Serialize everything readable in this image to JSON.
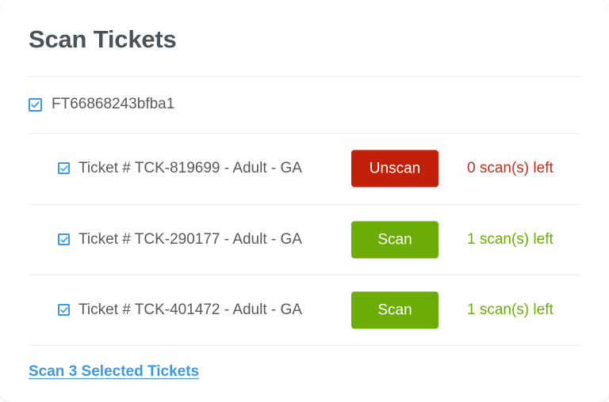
{
  "page": {
    "title": "Scan Tickets"
  },
  "order": {
    "code": "FT66868243bfba1",
    "checkbox_icon": "checkbox-checked-icon",
    "checked": true
  },
  "tickets": [
    {
      "label": "Ticket # TCK-819699 - Adult - GA",
      "action_label": "Unscan",
      "action_kind": "unscan",
      "status": "0 scan(s) left",
      "status_kind": "red",
      "checked": true
    },
    {
      "label": "Ticket # TCK-290177 - Adult - GA",
      "action_label": "Scan",
      "action_kind": "scan",
      "status": "1 scan(s) left",
      "status_kind": "green",
      "checked": true
    },
    {
      "label": "Ticket # TCK-401472 - Adult - GA",
      "action_label": "Scan",
      "action_kind": "scan",
      "status": "1 scan(s) left",
      "status_kind": "green",
      "checked": true
    }
  ],
  "footer": {
    "link_label": "Scan 3 Selected Tickets"
  },
  "colors": {
    "title_text": "#4a525a",
    "body_text": "#595959",
    "accent_blue": "#3d9ae2",
    "unscan_red": "#c22009",
    "status_red": "#c4301c",
    "scan_green": "#6cac08",
    "divider": "#ececec",
    "card_background": "#ffffff"
  }
}
